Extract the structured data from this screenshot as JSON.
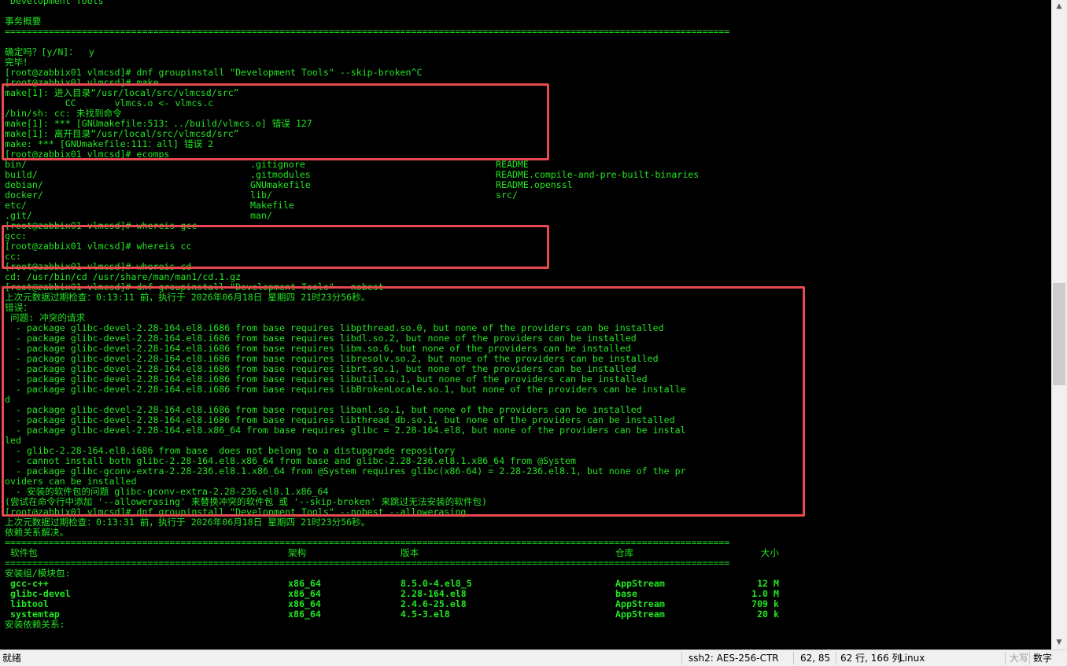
{
  "terminal": {
    "lines": [
      {
        "t": " Development Tools"
      },
      {
        "t": ""
      },
      {
        "t": "事务概要"
      },
      {
        "t": "===================================================================================================================================="
      },
      {
        "t": ""
      },
      {
        "t": "确定吗？[y/N]：  y"
      },
      {
        "t": "完毕！"
      },
      {
        "t": "[root@zabbix01 vlmcsd]# dnf groupinstall \"Development Tools\" --skip-broken^C"
      },
      {
        "t": "[root@zabbix01 vlmcsd]# make"
      },
      {
        "t": "make[1]: 进入目录“/usr/local/src/vlmcsd/src”"
      },
      {
        "t": "           CC       vlmcs.o <- vlmcs.c"
      },
      {
        "t": "/bin/sh: cc: 未找到命令"
      },
      {
        "t": "make[1]: *** [GNUmakefile:513：../build/vlmcs.o] 错误 127"
      },
      {
        "t": "make[1]: 离开目录“/usr/local/src/vlmcsd/src”"
      },
      {
        "t": "make: *** [GNUmakefile:111：all] 错误 2"
      },
      {
        "t": "[root@zabbix01 vlmcsd]# ecomps"
      },
      {
        "cols": [
          "bin/",
          ".gitignore",
          "README"
        ]
      },
      {
        "cols": [
          "build/",
          ".gitmodules",
          "README.compile-and-pre-built-binaries"
        ]
      },
      {
        "cols": [
          "debian/",
          "GNUmakefile",
          "README.openssl"
        ]
      },
      {
        "cols": [
          "docker/",
          "lib/",
          "src/"
        ]
      },
      {
        "cols": [
          "etc/",
          "Makefile",
          ""
        ]
      },
      {
        "cols": [
          ".git/",
          "man/",
          ""
        ]
      },
      {
        "t": "[root@zabbix01 vlmcsd]# whereis gcc"
      },
      {
        "t": "gcc:"
      },
      {
        "t": "[root@zabbix01 vlmcsd]# whereis cc"
      },
      {
        "t": "cc:"
      },
      {
        "t": "[root@zabbix01 vlmcsd]# whereis cd"
      },
      {
        "t": "cd: /usr/bin/cd /usr/share/man/man1/cd.1.gz"
      },
      {
        "t": "[root@zabbix01 vlmcsd]# dnf groupinstall \"Development Tools\" --nobest"
      },
      {
        "t": "上次元数据过期检查：0:13:11 前，执行于 2026年06月18日 星期四 21时23分56秒。"
      },
      {
        "t": "错误："
      },
      {
        "t": " 问题: 冲突的请求"
      },
      {
        "t": "  - package glibc-devel-2.28-164.el8.i686 from base requires libpthread.so.0, but none of the providers can be installed"
      },
      {
        "t": "  - package glibc-devel-2.28-164.el8.i686 from base requires libdl.so.2, but none of the providers can be installed"
      },
      {
        "t": "  - package glibc-devel-2.28-164.el8.i686 from base requires libm.so.6, but none of the providers can be installed"
      },
      {
        "t": "  - package glibc-devel-2.28-164.el8.i686 from base requires libresolv.so.2, but none of the providers can be installed"
      },
      {
        "t": "  - package glibc-devel-2.28-164.el8.i686 from base requires librt.so.1, but none of the providers can be installed"
      },
      {
        "t": "  - package glibc-devel-2.28-164.el8.i686 from base requires libutil.so.1, but none of the providers can be installed"
      },
      {
        "t": "  - package glibc-devel-2.28-164.el8.i686 from base requires libBrokenLocale.so.1, but none of the providers can be installe"
      },
      {
        "t": "d"
      },
      {
        "t": "  - package glibc-devel-2.28-164.el8.i686 from base requires libanl.so.1, but none of the providers can be installed"
      },
      {
        "t": "  - package glibc-devel-2.28-164.el8.i686 from base requires libthread_db.so.1, but none of the providers can be installed"
      },
      {
        "t": "  - package glibc-devel-2.28-164.el8.x86_64 from base requires glibc = 2.28-164.el8, but none of the providers can be instal"
      },
      {
        "t": "led"
      },
      {
        "t": "  - glibc-2.28-164.el8.i686 from base  does not belong to a distupgrade repository"
      },
      {
        "t": "  - cannot install both glibc-2.28-164.el8.x86_64 from base and glibc-2.28-236.el8.1.x86_64 from @System"
      },
      {
        "t": "  - package glibc-gconv-extra-2.28-236.el8.1.x86_64 from @System requires glibc(x86-64) = 2.28-236.el8.1, but none of the pr"
      },
      {
        "t": "oviders can be installed"
      },
      {
        "t": "  - 安装的软件包的问题 glibc-gconv-extra-2.28-236.el8.1.x86_64"
      },
      {
        "t": "(尝试在命令行中添加 '--allowerasing' 来替换冲突的软件包 或 '--skip-broken' 来跳过无法安装的软件包)"
      },
      {
        "t": "[root@zabbix01 vlmcsd]# dnf groupinstall \"Development Tools\" --nobest --allowerasing"
      },
      {
        "t": "上次元数据过期检查：0:13:31 前，执行于 2026年06月18日 星期四 21时23分56秒。"
      },
      {
        "t": "依赖关系解决。"
      },
      {
        "t": "===================================================================================================================================="
      },
      {
        "pkgcols": [
          " 软件包",
          "架构",
          "版本",
          "仓库",
          "大小"
        ]
      },
      {
        "t": "===================================================================================================================================="
      },
      {
        "t": "安装组/模块包:"
      },
      {
        "pkgcols": [
          " gcc-c++",
          "x86_64",
          "8.5.0-4.el8_5",
          "AppStream",
          "12 M"
        ],
        "b": true
      },
      {
        "pkgcols": [
          " glibc-devel",
          "x86_64",
          "2.28-164.el8",
          "base",
          "1.0 M"
        ],
        "b": true
      },
      {
        "pkgcols": [
          " libtool",
          "x86_64",
          "2.4.6-25.el8",
          "AppStream",
          "709 k"
        ],
        "b": true
      },
      {
        "pkgcols": [
          " systemtap",
          "x86_64",
          "4.5-3.el8",
          "AppStream",
          "20 k"
        ],
        "b": true
      },
      {
        "t": "安装依赖关系:"
      }
    ]
  },
  "scrollbar": {
    "up_arrow": "▲",
    "down_arrow": "▼"
  },
  "statusbar": {
    "status": "就绪",
    "connection": "ssh2: AES-256-CTR",
    "cursor_pos": "62,  85",
    "dimensions": "62 行, 166 列",
    "os": "Linux",
    "caps": "大写",
    "num": "数字"
  }
}
